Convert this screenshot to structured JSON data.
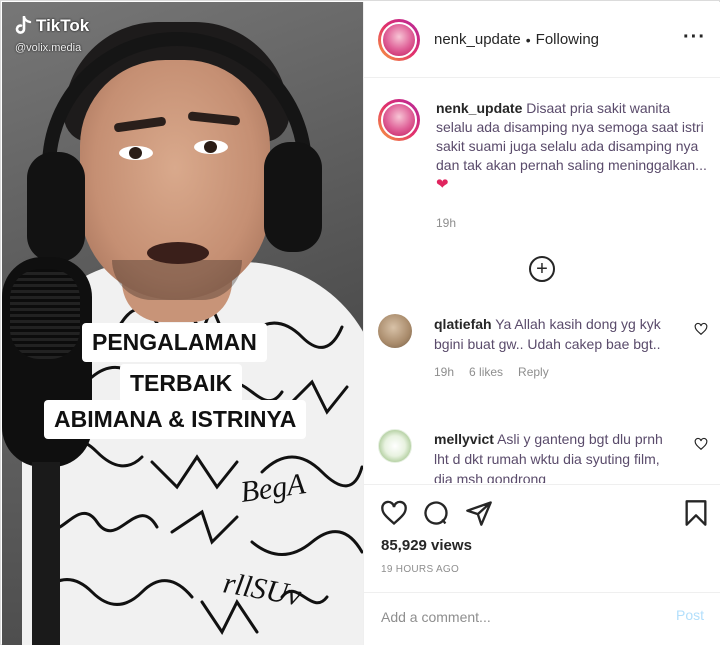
{
  "media": {
    "watermark": {
      "brand": "TikTok",
      "handle": "@volix.media"
    },
    "caption_lines": [
      "PENGALAMAN",
      "TERBAIK",
      "ABIMANA & ISTRINYA"
    ]
  },
  "header": {
    "username": "nenk_update",
    "separator": "•",
    "follow_status": "Following",
    "more_icon": "more-horizontal-icon"
  },
  "post_caption": {
    "username": "nenk_update",
    "text": "Disaat pria sakit wanita selalu ada disamping nya semoga saat istri sakit suami juga selalu ada disamping nya dan tak akan pernah saling meninggalkan...",
    "emoji": "❤",
    "time": "19h"
  },
  "load_more_icon": "plus-circle-icon",
  "comments": [
    {
      "username": "qlatiefah",
      "text": "Ya Allah kasih dong yg kyk bgini buat gw.. Udah cakep bae bgt..",
      "time": "19h",
      "likes": "6 likes",
      "reply": "Reply"
    },
    {
      "username": "mellyvict",
      "text": "Asli y ganteng bgt dlu prnh lht d dkt rumah wktu dia syuting film, dia msh gondrong"
    }
  ],
  "actions": {
    "icons": [
      "heart-icon",
      "comment-icon",
      "share-icon",
      "bookmark-icon"
    ],
    "views": "85,929 views",
    "posted_ago": "19 HOURS AGO"
  },
  "add_comment": {
    "placeholder": "Add a comment...",
    "post_label": "Post"
  },
  "colors": {
    "text": "#262626",
    "muted": "#8e8e8e",
    "post_disabled": "#b2dffc",
    "heart": "#e0245e"
  }
}
